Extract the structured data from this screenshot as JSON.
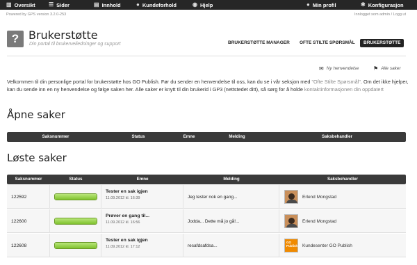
{
  "nav": {
    "items": [
      {
        "label": "Oversikt",
        "icon": "bars-icon"
      },
      {
        "label": "Sider",
        "icon": "list-icon"
      },
      {
        "label": "Innhold",
        "icon": "document-icon"
      },
      {
        "label": "Kundeforhold",
        "icon": "user-icon"
      },
      {
        "label": "Hjelp",
        "icon": "help-icon"
      },
      {
        "label": "Min profil",
        "icon": "user-icon"
      },
      {
        "label": "Konfigurasjon",
        "icon": "gear-icon"
      }
    ]
  },
  "powered": "Powered by GPS version 3.2.0-253",
  "logged_in": "Innlogget som admin",
  "logout": "Logg ut",
  "header": {
    "title": "Brukerstøtte",
    "subtitle": "Din portal til brukerveiledninger og support",
    "tabs": [
      {
        "label": "BRUKERSTØTTE MANAGER",
        "active": false
      },
      {
        "label": "OFTE STILTE SPØRSMÅL",
        "active": false
      },
      {
        "label": "BRUKERSTØTTE",
        "active": true
      }
    ]
  },
  "actions": {
    "new_inquiry": "Ny henvendelse",
    "all_cases": "Alle saker"
  },
  "intro": {
    "part1": "Velkommen til din personlige portal for brukerstøtte hos GO Publish. Før du sender en henvendelse til oss, kan du se i vår seksjon med ",
    "faq_link": "\"Ofte Stilte Spørsmål\"",
    "part2": ". Om det ikke hjelper, kan du sende inn en ny henvendelse og følge saken her. Alle saker er knytt til din brukerid i GP3 (nettstedet ditt), så sørg for å holde ",
    "contact_link": "kontaktinformasjonen din oppdatert"
  },
  "open_cases": {
    "title": "Åpne saker",
    "columns": [
      "Saksnummer",
      "Status",
      "Emne",
      "Melding",
      "Saksbehandler"
    ]
  },
  "solved_cases": {
    "title": "Løste saker",
    "columns": [
      "Saksnummer",
      "Status",
      "Emne",
      "Melding",
      "Saksbehandler"
    ],
    "rows": [
      {
        "number": "122592",
        "progress": 1.0,
        "subject": "Tester en sak igjen",
        "date": "11.09.2012 kl. 16:39",
        "message": "Jeg tester nok en gang...",
        "handler": "Erlend Mongstad",
        "avatar": "person"
      },
      {
        "number": "122600",
        "progress": 1.0,
        "subject": "Prøver en gang til...",
        "date": "11.09.2012 kl. 16:56",
        "message": "Jodda... Dette må jo gå!...",
        "handler": "Erlend Mongstad",
        "avatar": "person"
      },
      {
        "number": "122608",
        "progress": 1.0,
        "subject": "Tester en sak igjen",
        "date": "11.09.2012 kl. 17:12",
        "message": "resafdsafdsa...",
        "handler": "Kundesenter GO Publish",
        "avatar": "gp",
        "avatar_text": "GO Publish"
      }
    ]
  },
  "colors": {
    "topbar": "#262626",
    "table_header": "#3a3a3a",
    "progress": "#8cc63f",
    "avatar_brand": "#f08a00"
  }
}
